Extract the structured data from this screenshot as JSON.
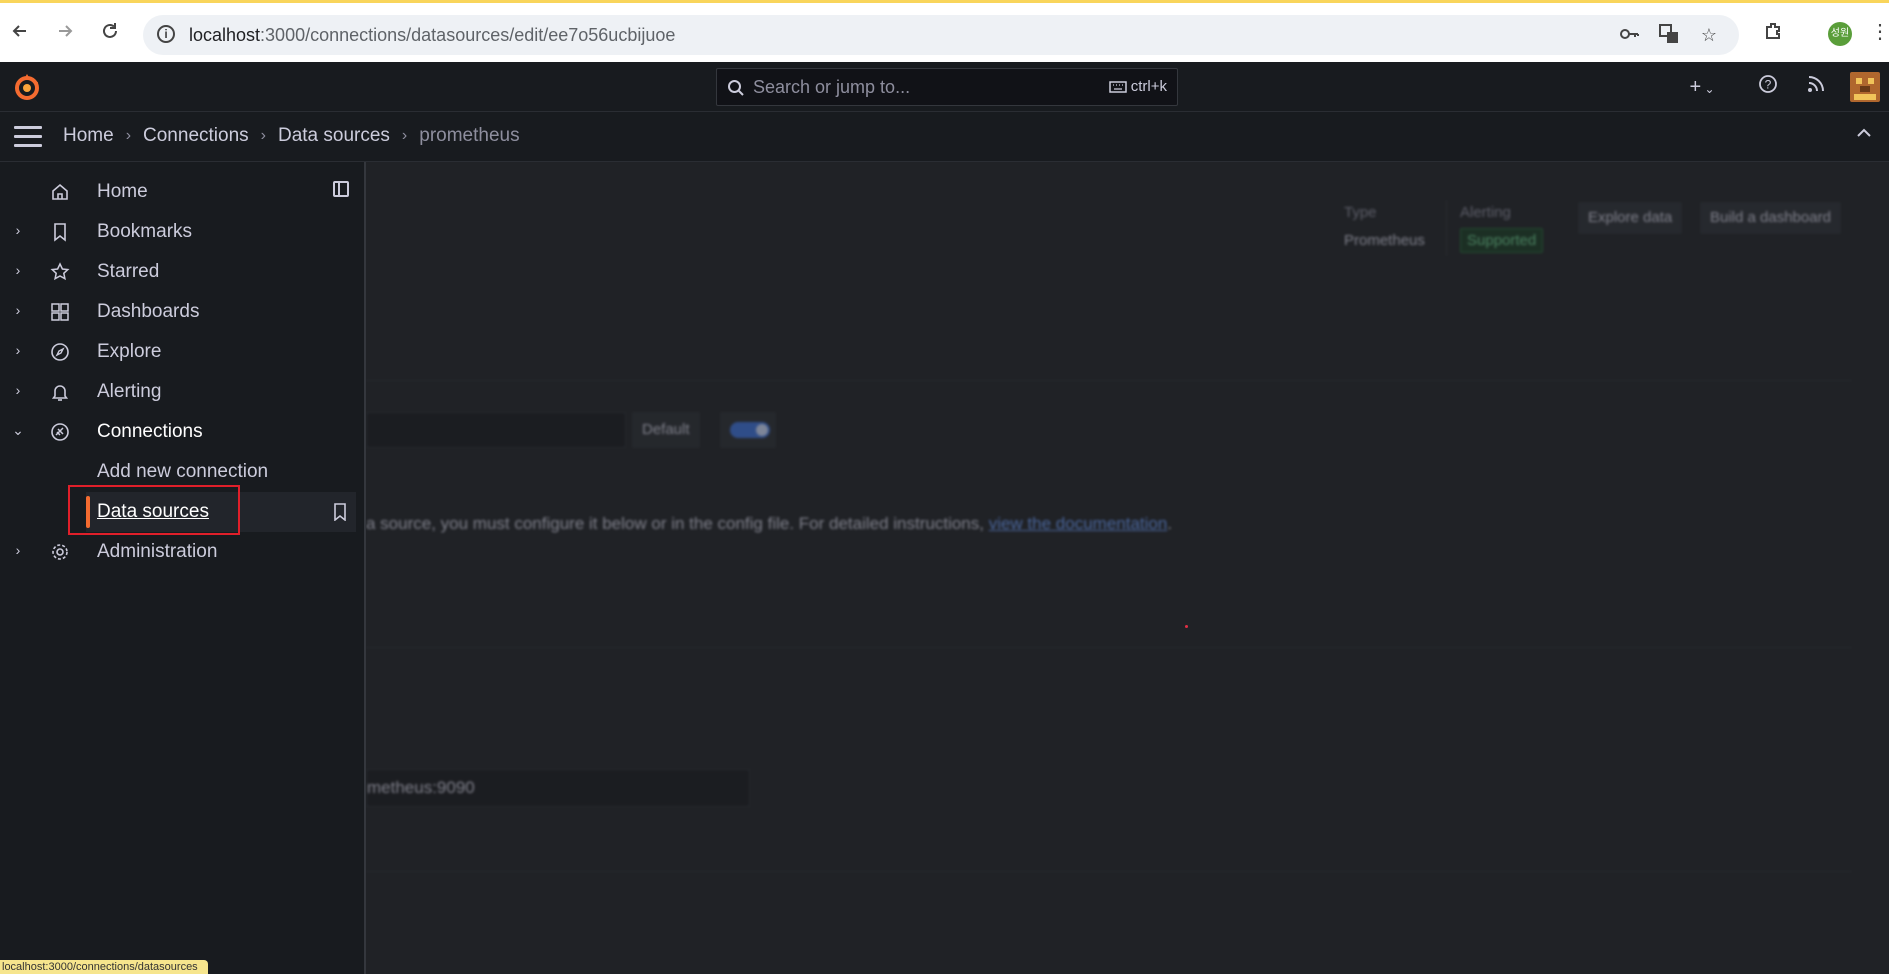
{
  "browser": {
    "url_host": "localhost",
    "url_path": ":3000/connections/datasources/edit/ee7o56ucbijuoe",
    "profile_label": "성원",
    "status_url": "localhost:3000/connections/datasources"
  },
  "topbar": {
    "search_placeholder": "Search or jump to...",
    "search_shortcut": "ctrl+k",
    "add_label": "+"
  },
  "breadcrumbs": [
    "Home",
    "Connections",
    "Data sources",
    "prometheus"
  ],
  "sidebar": {
    "items": [
      {
        "label": "Home",
        "icon": "home-icon",
        "expandable": false
      },
      {
        "label": "Bookmarks",
        "icon": "bookmark-icon",
        "expandable": true
      },
      {
        "label": "Starred",
        "icon": "star-icon",
        "expandable": true
      },
      {
        "label": "Dashboards",
        "icon": "grid-icon",
        "expandable": true
      },
      {
        "label": "Explore",
        "icon": "compass-icon",
        "expandable": true
      },
      {
        "label": "Alerting",
        "icon": "bell-icon",
        "expandable": true
      },
      {
        "label": "Connections",
        "icon": "connections-icon",
        "expandable": true,
        "expanded": true
      },
      {
        "label": "Add new connection",
        "child": true
      },
      {
        "label": "Data sources",
        "child": true,
        "active": true
      },
      {
        "label": "Administration",
        "icon": "gear-icon",
        "expandable": true
      }
    ]
  },
  "main": {
    "type_label": "Type",
    "type_value": "Prometheus",
    "alerting_label": "Alerting",
    "alerting_value": "Supported",
    "explore_button": "Explore data",
    "build_button": "Build a dashboard",
    "default_label": "Default",
    "info_text": "a source, you must configure it below or in the config file. For detailed instructions, ",
    "info_link": "view the documentation",
    "info_tail": ".",
    "url_value": "metheus:9090"
  },
  "colors": {
    "accent": "#f46b30",
    "link": "#6e9fff",
    "highlight": "#e01f2a"
  }
}
